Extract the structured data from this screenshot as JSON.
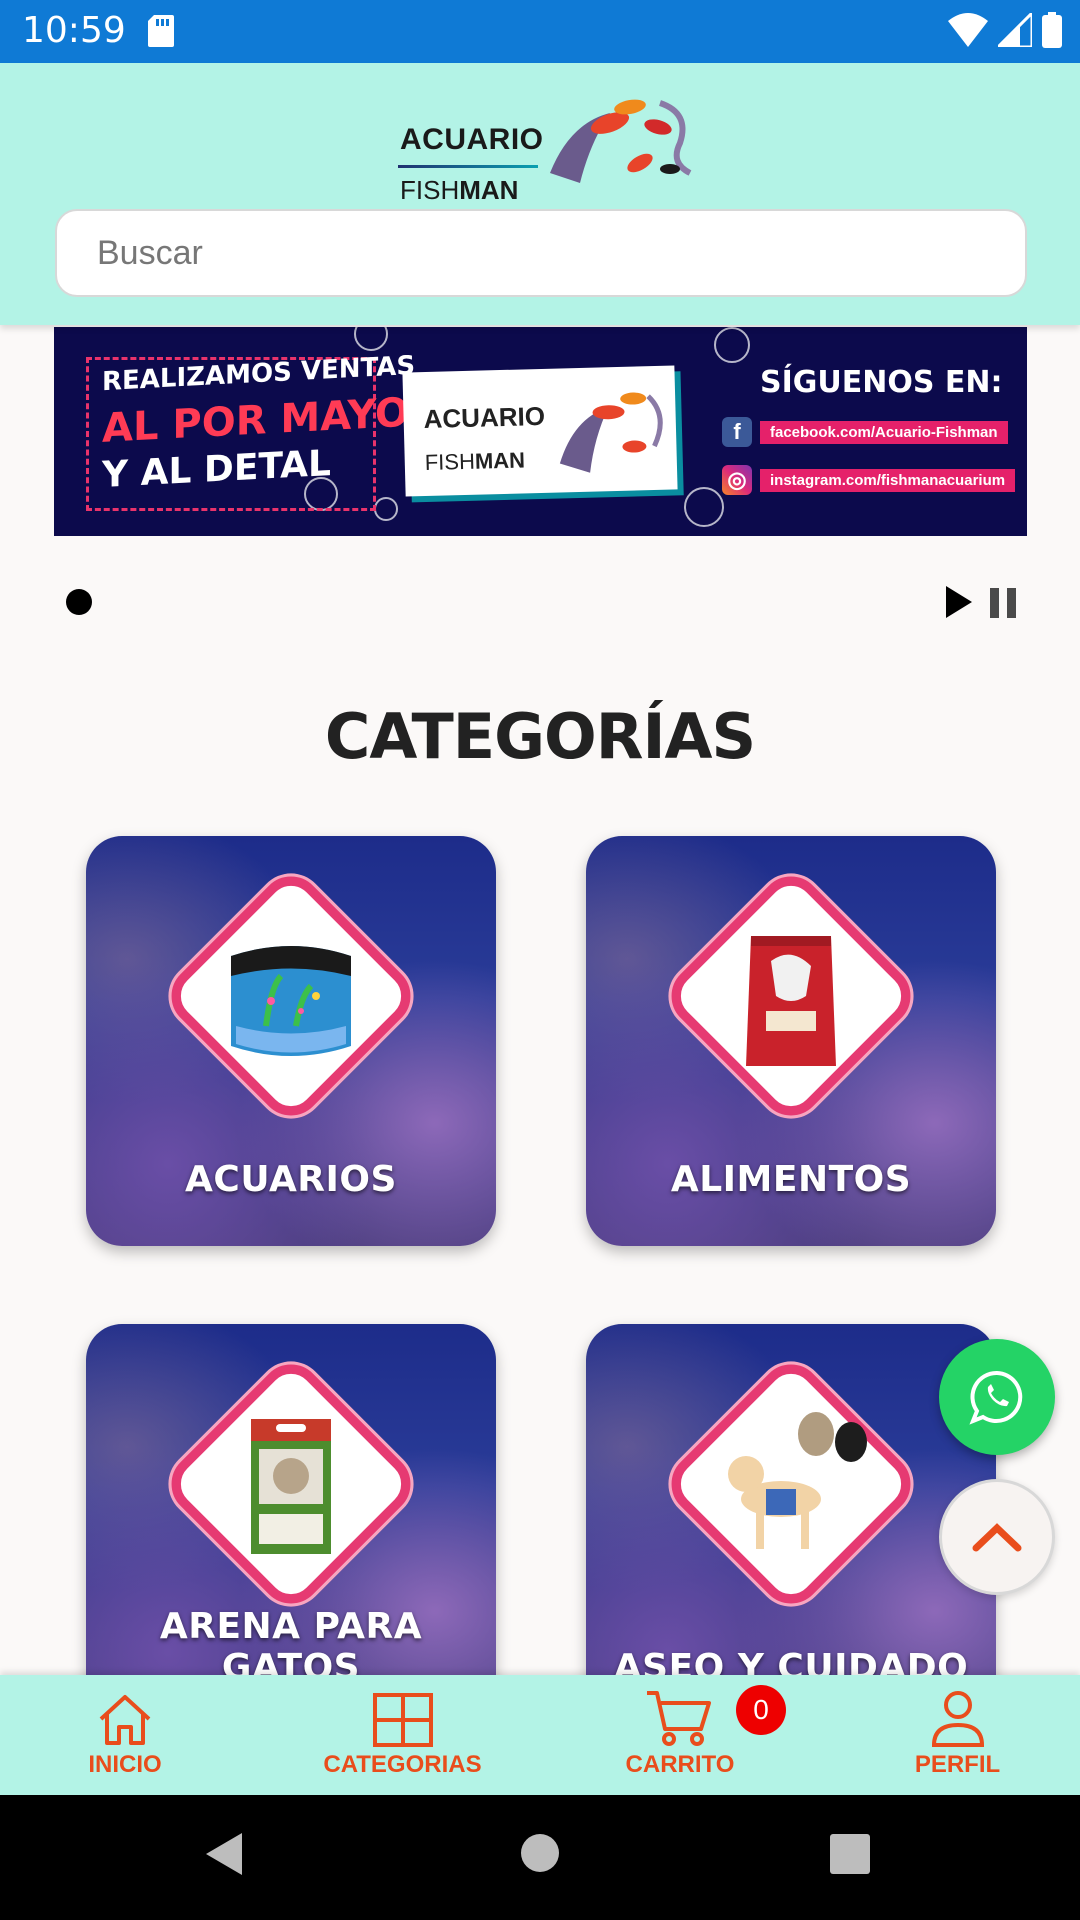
{
  "status_bar": {
    "time": "10:59"
  },
  "header": {
    "logo": {
      "line1": "ACUARIO",
      "line2_light": "FISH",
      "line2_bold": "MAN"
    },
    "search": {
      "placeholder": "Buscar"
    }
  },
  "banner": {
    "line1": "REALIZAMOS VENTAS",
    "line2": "AL POR MAYOR",
    "line3": "Y AL DETAL",
    "logo_line1": "ACUARIO",
    "logo_line2_light": "FISH",
    "logo_line2_bold": "MAN",
    "follow": "SÍGUENOS EN:",
    "facebook": "facebook.com/Acuario-Fishman",
    "instagram": "instagram.com/fishmanacuarium"
  },
  "section_title": "CATEGORÍAS",
  "categories": [
    {
      "label": "ACUARIOS"
    },
    {
      "label": "ALIMENTOS"
    },
    {
      "label": "ARENA PARA GATOS"
    },
    {
      "label": "ASEO Y CUIDADO"
    }
  ],
  "bottom_nav": {
    "inicio": "INICIO",
    "categorias": "CATEGORIAS",
    "carrito": "CARRITO",
    "cart_count": "0",
    "perfil": "PERFIL"
  },
  "colors": {
    "status_bar": "#0f7ad5",
    "header_bg": "#b3f3e6",
    "nav_accent": "#e94d1c",
    "whatsapp": "#24d366",
    "badge": "#ee0000"
  }
}
